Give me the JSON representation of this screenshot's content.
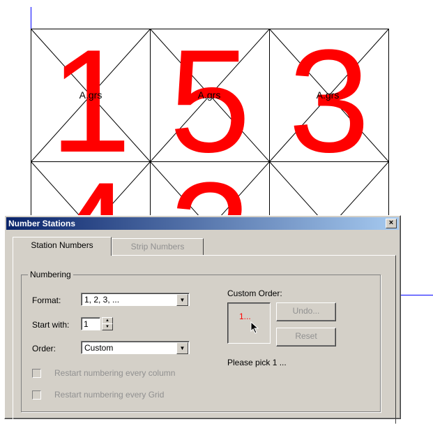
{
  "canvas": {
    "cells": [
      {
        "number": "1",
        "label": "A.grs"
      },
      {
        "number": "5",
        "label": "A.grs"
      },
      {
        "number": "3",
        "label": "A.grs"
      },
      {
        "number": "4",
        "label": ""
      },
      {
        "number": "2",
        "label": ""
      },
      {
        "number": "",
        "label": ""
      }
    ],
    "number_color": "#ff0000"
  },
  "dialog": {
    "title": "Number Stations",
    "close_glyph": "×",
    "tabs": [
      {
        "label": "Station Numbers",
        "active": true
      },
      {
        "label": "Strip Numbers",
        "active": false
      }
    ],
    "group_title": "Numbering",
    "format_label": "Format:",
    "format_value": "1, 2, 3, ...",
    "start_label": "Start with:",
    "start_value": "1",
    "order_label": "Order:",
    "order_value": "Custom",
    "restart_column": "Restart numbering every column",
    "restart_grid": "Restart numbering every Grid",
    "custom_order_label": "Custom Order:",
    "custom_pick_value": "1...",
    "undo_label": "Undo...",
    "reset_label": "Reset",
    "status_text": "Please pick 1 ..."
  },
  "colors": {
    "title_start": "#0a246a",
    "title_end": "#a6caf0",
    "face": "#d4d0c8",
    "guide": "#0000ff"
  }
}
